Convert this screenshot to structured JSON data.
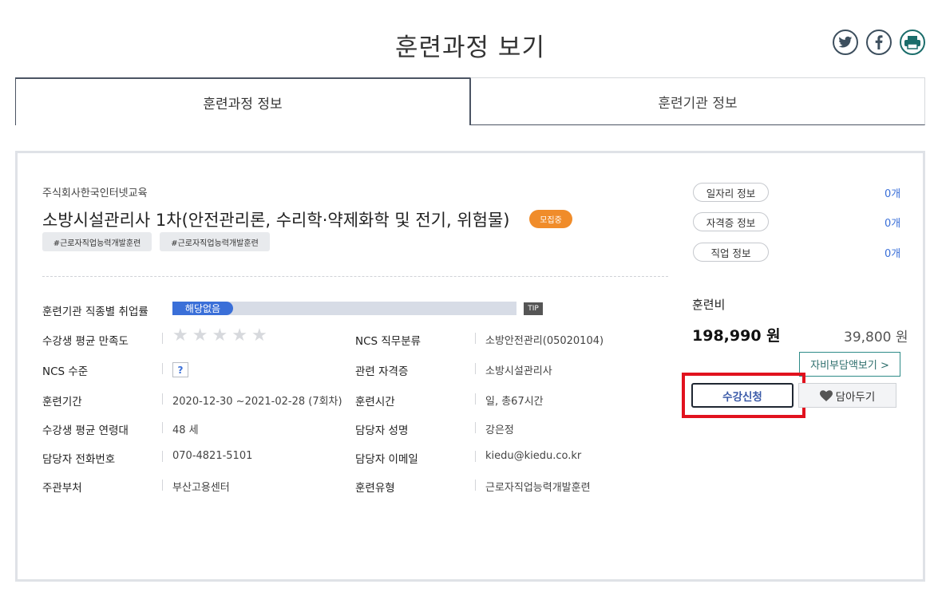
{
  "page": {
    "title": "훈련과정 보기"
  },
  "share": [
    {
      "name": "twitter-icon",
      "color": "#3d4f5e"
    },
    {
      "name": "facebook-icon",
      "color": "#3d4f5e"
    },
    {
      "name": "print-icon",
      "color": "#1b6d6b"
    }
  ],
  "tabs": [
    {
      "label": "훈련과정 정보",
      "active": true
    },
    {
      "label": "훈련기관 정보",
      "active": false
    }
  ],
  "course": {
    "org": "주식회사한국인터넷교육",
    "title": "소방시설관리사 1차(안전관리론, 수리학·약제화학 및 전기, 위험물)",
    "status_badge": "모집중",
    "hashtags": [
      "#근로자직업능력개발훈련",
      "#근로자직업능력개발훈련"
    ]
  },
  "details": {
    "employment_rate": {
      "label": "훈련기관 직종별 취업률",
      "bar_text": "해당없음",
      "tip": "TIP"
    },
    "satisfaction": {
      "label": "수강생 평균 만족도",
      "stars_filled": 0,
      "stars_total": 5
    },
    "ncs_level": {
      "label": "NCS 수준",
      "value": "?"
    },
    "period": {
      "label": "훈련기간",
      "value": "2020-12-30 ~2021-02-28 (7회차)"
    },
    "age": {
      "label": "수강생 평균 연령대",
      "value": "48 세"
    },
    "phone": {
      "label": "담당자 전화번호",
      "value": "070-4821-5101"
    },
    "ministry": {
      "label": "주관부처",
      "value": "부산고용센터"
    },
    "ncs_category": {
      "label": "NCS 직무분류",
      "value": "소방안전관리(05020104)"
    },
    "certificate": {
      "label": "관련 자격증",
      "value": "소방시설관리사"
    },
    "hours": {
      "label": "훈련시간",
      "value": "일, 총67시간"
    },
    "manager": {
      "label": "담당자 성명",
      "value": "강은정"
    },
    "email": {
      "label": "담당자 이메일",
      "value": "kiedu@kiedu.co.kr"
    },
    "type": {
      "label": "훈련유형",
      "value": "근로자직업능력개발훈련"
    }
  },
  "side": {
    "info": [
      {
        "label": "일자리 정보",
        "count": "0개"
      },
      {
        "label": "자격증 정보",
        "count": "0개"
      },
      {
        "label": "직업 정보",
        "count": "0개"
      }
    ],
    "fee_label": "훈련비",
    "fee_amount": "198,990 원",
    "self_pay": "39,800 원",
    "self_pay_button": "자비부담액보기 >",
    "enroll_button": "수강신청",
    "wishlist_button": "담아두기",
    "highlight_color": "#e1121e"
  }
}
